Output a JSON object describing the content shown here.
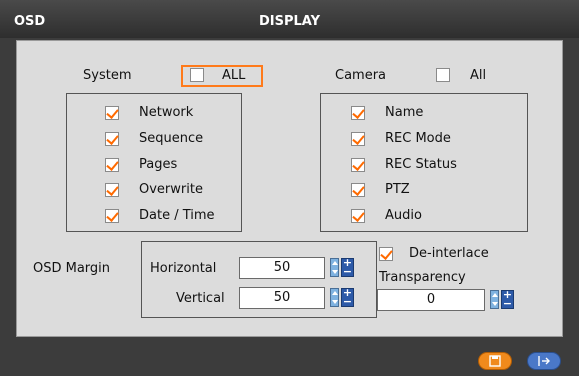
{
  "titlebar": {
    "left": "OSD",
    "center": "DISPLAY"
  },
  "system": {
    "label": "System",
    "all_label": "ALL",
    "all_checked": false,
    "items": [
      {
        "label": "Network",
        "checked": true
      },
      {
        "label": "Sequence",
        "checked": true
      },
      {
        "label": "Pages",
        "checked": true
      },
      {
        "label": "Overwrite",
        "checked": true
      },
      {
        "label": "Date / Time",
        "checked": true
      }
    ]
  },
  "camera": {
    "label": "Camera",
    "all_label": "All",
    "all_checked": false,
    "items": [
      {
        "label": "Name",
        "checked": true
      },
      {
        "label": "REC Mode",
        "checked": true
      },
      {
        "label": "REC Status",
        "checked": true
      },
      {
        "label": "PTZ",
        "checked": true
      },
      {
        "label": "Audio",
        "checked": true
      }
    ]
  },
  "osd_margin": {
    "label": "OSD Margin",
    "horizontal_label": "Horizontal",
    "horizontal_value": "50",
    "vertical_label": "Vertical",
    "vertical_value": "50"
  },
  "deinterlace": {
    "label": "De-interlace",
    "checked": true
  },
  "transparency": {
    "label": "Transparency",
    "value": "0"
  },
  "buttons": {
    "save_icon": "save-icon",
    "exit_icon": "exit-icon"
  },
  "colors": {
    "accent": "#ff7a1a",
    "button_blue": "#2d5aa8"
  }
}
